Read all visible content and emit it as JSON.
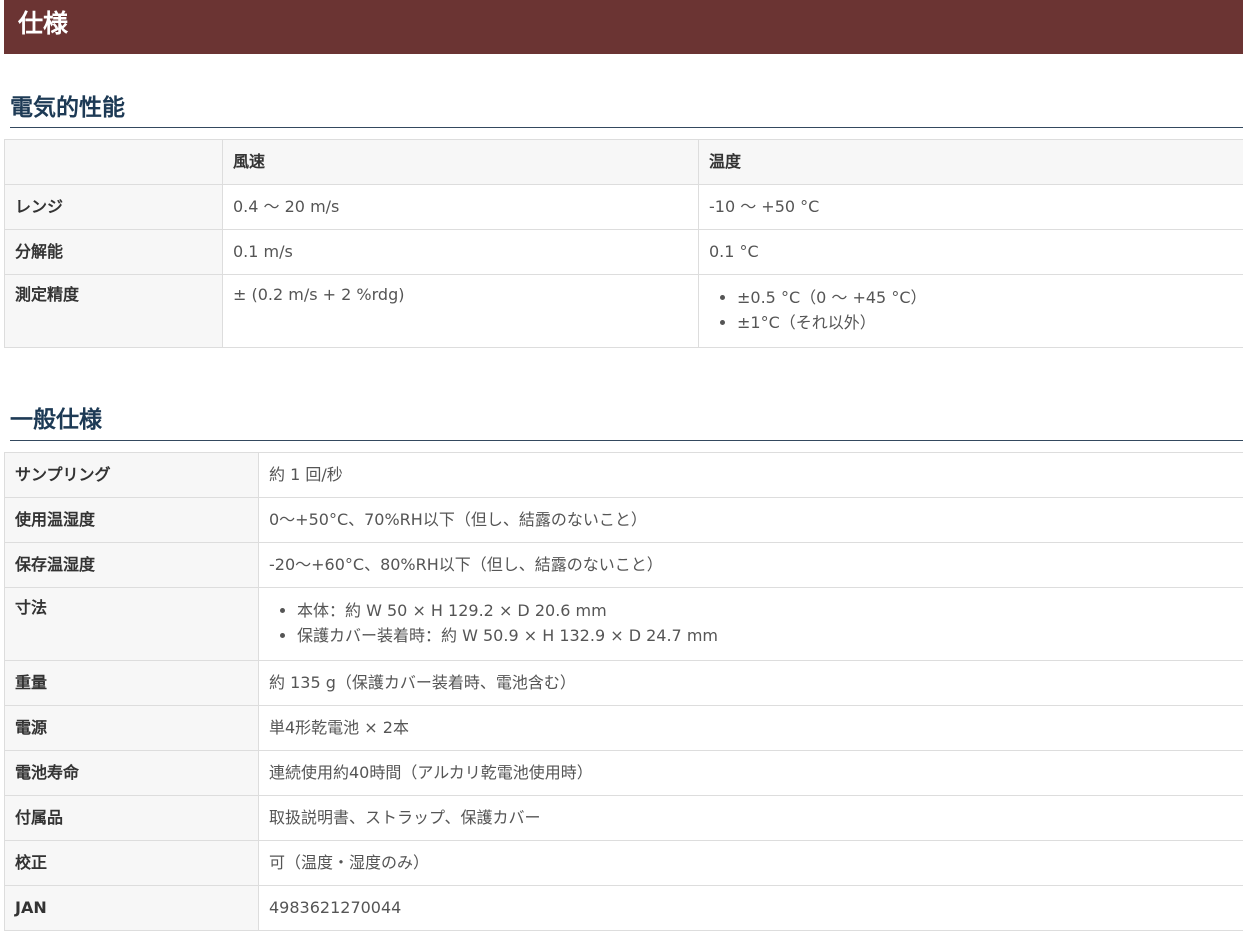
{
  "page_title": "仕様",
  "electrical": {
    "title": "電気的性能",
    "columns": [
      "",
      "風速",
      "温度"
    ],
    "rows": [
      {
        "label": "レンジ",
        "wind": "0.4 ～ 20 m/s",
        "temp": "-10 ～ +50 °C"
      },
      {
        "label": "分解能",
        "wind": "0.1 m/s",
        "temp": "0.1 °C"
      },
      {
        "label": "測定精度",
        "wind": "± (0.2 m/s + 2 %rdg)",
        "temp_items": [
          "±0.5 °C（0 ～ +45 °C）",
          "±1°C（それ以外）"
        ]
      }
    ]
  },
  "general": {
    "title": "一般仕様",
    "rows": [
      {
        "label": "サンプリング",
        "value": "約 1 回/秒"
      },
      {
        "label": "使用温湿度",
        "value": "0～+50°C、70%RH以下（但し、結露のないこと）"
      },
      {
        "label": "保存温湿度",
        "value": "-20～+60°C、80%RH以下（但し、結露のないこと）"
      },
      {
        "label": "寸法",
        "items": [
          "本体：約 W 50 × H 129.2 × D 20.6 mm",
          "保護カバー装着時：約 W 50.9 × H 132.9 × D 24.7 mm"
        ]
      },
      {
        "label": "重量",
        "value": "約 135 g（保護カバー装着時、電池含む）"
      },
      {
        "label": "電源",
        "value": "単4形乾電池 × 2本"
      },
      {
        "label": "電池寿命",
        "value": "連続使用約40時間（アルカリ乾電池使用時）"
      },
      {
        "label": "付属品",
        "value": "取扱説明書、ストラップ、保護カバー"
      },
      {
        "label": "校正",
        "value": "可（温度・湿度のみ）"
      },
      {
        "label": "JAN",
        "value": "4983621270044"
      }
    ]
  },
  "colors": {
    "banner": "#6b3433",
    "section_title": "#1d3a55",
    "header_bg": "#f7f7f7",
    "border": "#dddddd"
  }
}
